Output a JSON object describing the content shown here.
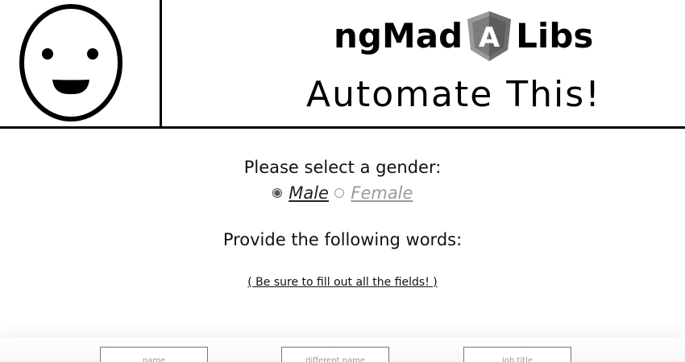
{
  "header": {
    "brand_left": "ngMad",
    "brand_right": "Libs",
    "shield_letter": "A",
    "tagline": "Automate This!"
  },
  "icons": {
    "smiley": "smiley-face-icon",
    "shield": "angular-shield-icon"
  },
  "colors": {
    "shield_dark": "#6e6e6e",
    "shield_light": "#9a9a9a",
    "inactive_option": "#9a9a9a"
  },
  "gender": {
    "prompt": "Please select a gender:",
    "options": [
      {
        "label": "Male",
        "selected": true
      },
      {
        "label": "Female",
        "selected": false
      }
    ]
  },
  "words": {
    "prompt": "Provide the following words:",
    "hint": "( Be sure to fill out all the fields! )"
  },
  "fields": [
    {
      "placeholder": "name"
    },
    {
      "placeholder": "different name"
    },
    {
      "placeholder": "job title"
    }
  ]
}
